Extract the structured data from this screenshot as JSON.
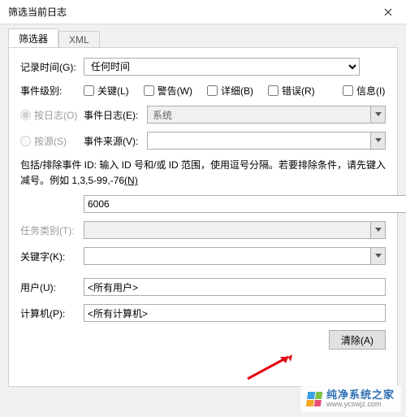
{
  "window": {
    "title": "筛选当前日志"
  },
  "tabs": {
    "filter": "筛选器",
    "xml": "XML"
  },
  "labels": {
    "logged": "记录时间(G):",
    "level": "事件级别:",
    "byLog": "按日志(O)",
    "bySource": "按源(S)",
    "eventLog": "事件日志(E):",
    "eventSource": "事件来源(V):",
    "taskCat": "任务类别(T):",
    "keywords": "关键字(K):",
    "user": "用户(U):",
    "computer": "计算机(P):"
  },
  "values": {
    "loggedSelected": "任何时间",
    "eventLogValue": "系统",
    "eventSourceValue": "",
    "idInput": "6006",
    "taskCatValue": "",
    "keywordsValue": "",
    "userValue": "<所有用户>",
    "computerValue": "<所有计算机>"
  },
  "checks": {
    "critical": "关键(L)",
    "warning": "警告(W)",
    "verbose": "详细(B)",
    "error": "错误(R)",
    "info": "信息(I)"
  },
  "hint": {
    "line1": "包括/排除事件 ID: 输入 ID 号和/或 ID 范围，使用逗号分隔。若要排除条件，请先键入",
    "line2pre": "减号。例如 1,3,5-99,-76",
    "line2link": "(N)"
  },
  "buttons": {
    "clear": "清除(A)"
  },
  "watermark": {
    "cn": "纯净系统之家",
    "url": "www.ycswjz.com"
  }
}
